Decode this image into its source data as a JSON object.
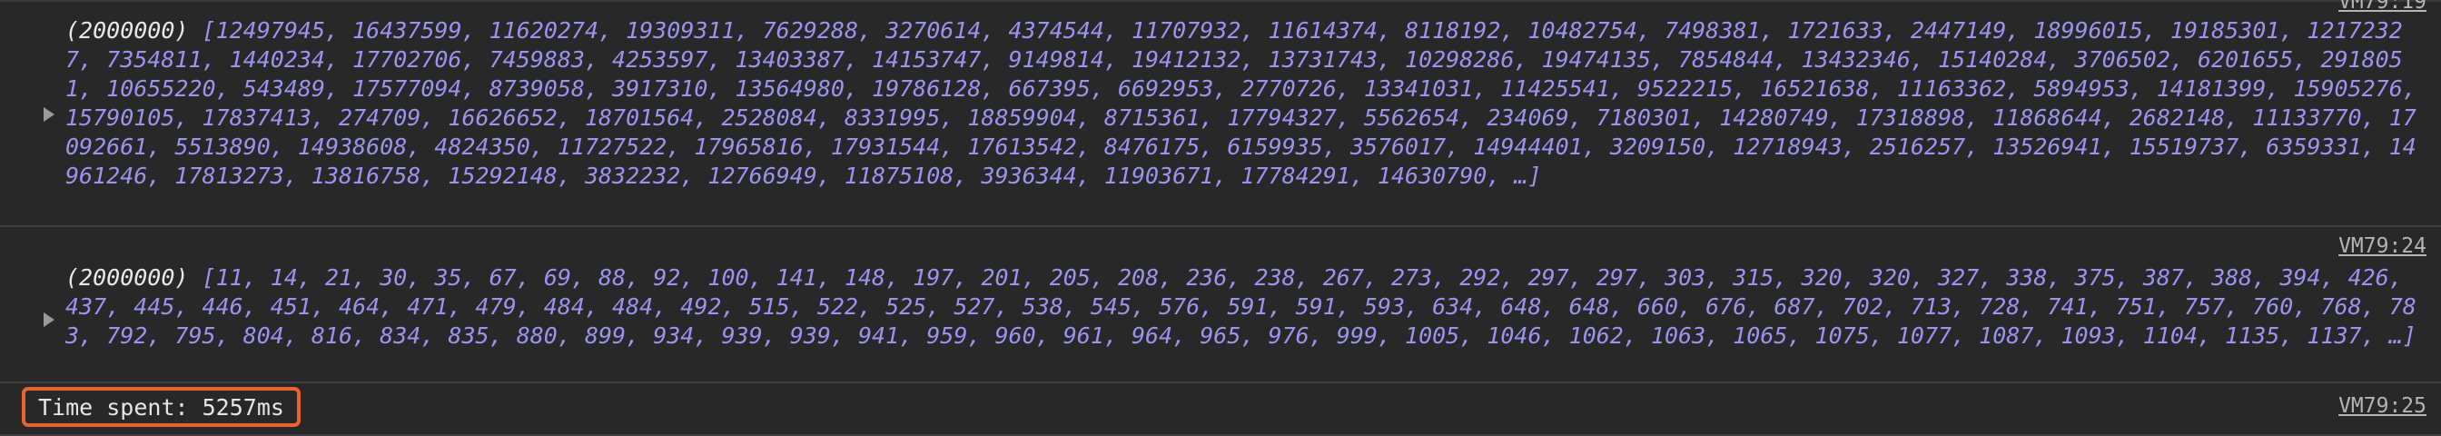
{
  "console": {
    "entries": [
      {
        "source": "VM79:19",
        "count": "(2000000)",
        "values": "[12497945, 16437599, 11620274, 19309311, 7629288, 3270614, 4374544, 11707932, 11614374, 8118192, 10482754, 7498381, 1721633, 2447149, 18996015, 19185301, 12172327, 7354811, 1440234, 17702706, 7459883, 4253597, 13403387, 14153747, 9149814, 19412132, 13731743, 10298286, 19474135, 7854844, 13432346, 15140284, 3706502, 6201655, 2918051, 10655220, 543489, 17577094, 8739058, 3917310, 13564980, 19786128, 667395, 6692953, 2770726, 13341031, 11425541, 9522215, 16521638, 11163362, 5894953, 14181399, 15905276, 15790105, 17837413, 274709, 16626652, 18701564, 2528084, 8331995, 18859904, 8715361, 17794327, 5562654, 234069, 7180301, 14280749, 17318898, 11868644, 2682148, 11133770, 17092661, 5513890, 14938608, 4824350, 11727522, 17965816, 17931544, 17613542, 8476175, 6159935, 3576017, 14944401, 3209150, 12718943, 2516257, 13526941, 15519737, 6359331, 14961246, 17813273, 13816758, 15292148, 3832232, 12766949, 11875108, 3936344, 11903671, 17784291, 14630790, …]"
      },
      {
        "source": "VM79:24",
        "count": "(2000000)",
        "values": "[11, 14, 21, 30, 35, 67, 69, 88, 92, 100, 141, 148, 197, 201, 205, 208, 236, 238, 267, 273, 292, 297, 297, 303, 315, 320, 320, 327, 338, 375, 387, 388, 394, 426, 437, 445, 446, 451, 464, 471, 479, 484, 484, 492, 515, 522, 525, 527, 538, 545, 576, 591, 591, 593, 634, 648, 648, 660, 676, 687, 702, 713, 728, 741, 751, 757, 760, 768, 783, 792, 795, 804, 816, 834, 835, 880, 899, 934, 939, 939, 941, 959, 960, 961, 964, 965, 976, 999, 1005, 1046, 1062, 1063, 1065, 1075, 1077, 1087, 1093, 1104, 1135, 1137, …]"
      },
      {
        "source": "VM79:25",
        "text": "Time spent: 5257ms"
      }
    ]
  },
  "colors": {
    "background": "#282828",
    "array_numbers": "#9b93ef",
    "highlight_box": "#e8632f",
    "source_link": "#b4b4b4"
  },
  "icons": {
    "expander": "triangle-right-icon"
  }
}
